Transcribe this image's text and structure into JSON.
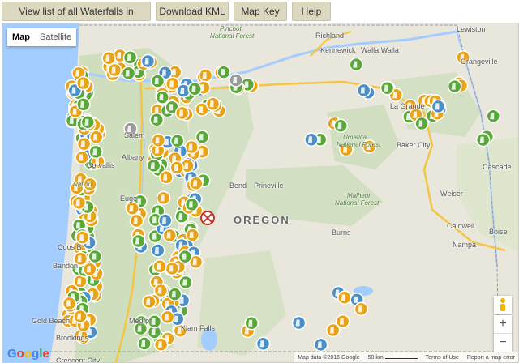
{
  "toolbar": {
    "list_label": "View list of all Waterfalls in Oregon",
    "kml_label": "Download KML",
    "key_label": "Map Key",
    "help_label": "Help"
  },
  "map": {
    "type_map": "Map",
    "type_satellite": "Satellite",
    "labels": {
      "richland": "Richland",
      "kennewick": "Kennewick",
      "walla_walla": "Walla Walla",
      "lewiston": "Lewiston",
      "pinchot": "Pinchot",
      "national_forest_1": "National Forest",
      "grangeville": "Grangeville",
      "la_grande": "La Grande",
      "umatilla": "Umatilla",
      "national_forest_2": "National Forest",
      "baker_city": "Baker City",
      "salem": "Salem",
      "albany": "Albany",
      "corvallis": "Corvallis",
      "eugene": "Euge",
      "prineville": "Prineville",
      "bend": "Bend",
      "malheur": "Malheur",
      "national_forest_3": "National Forest",
      "oregon": "OREGON",
      "burns": "Burns",
      "caldwell": "Caldwell",
      "boise": "Boise",
      "nampa": "Nampa",
      "cascade": "Cascade",
      "weiser": "Weiser",
      "coos_bay": "Coos B",
      "bandon": "Bandon",
      "gold_beach": "Gold Beach",
      "brookings": "Brookings",
      "medford": "Medfor",
      "klamath_falls": "Klam    Falls",
      "crescent_city": "Crescent City",
      "national_1": "Nation"
    },
    "google_logo": "Google",
    "footer": {
      "data": "Map data ©2016 Google",
      "scale": "50 km",
      "terms": "Terms of Use",
      "report": "Report a map error"
    },
    "zoom_in": "+",
    "zoom_out": "−",
    "pegman_icon": "pegman-icon",
    "marker_icon": "waterfall-marker-icon",
    "colors": {
      "marker_orange": "#e8a318",
      "marker_green": "#5aa83a",
      "marker_blue": "#4a8fc7",
      "marker_gray": "#9a9a9a",
      "marker_red": "#c0392b",
      "forest": "#c6dcb4",
      "highway": "#f4c542"
    }
  }
}
